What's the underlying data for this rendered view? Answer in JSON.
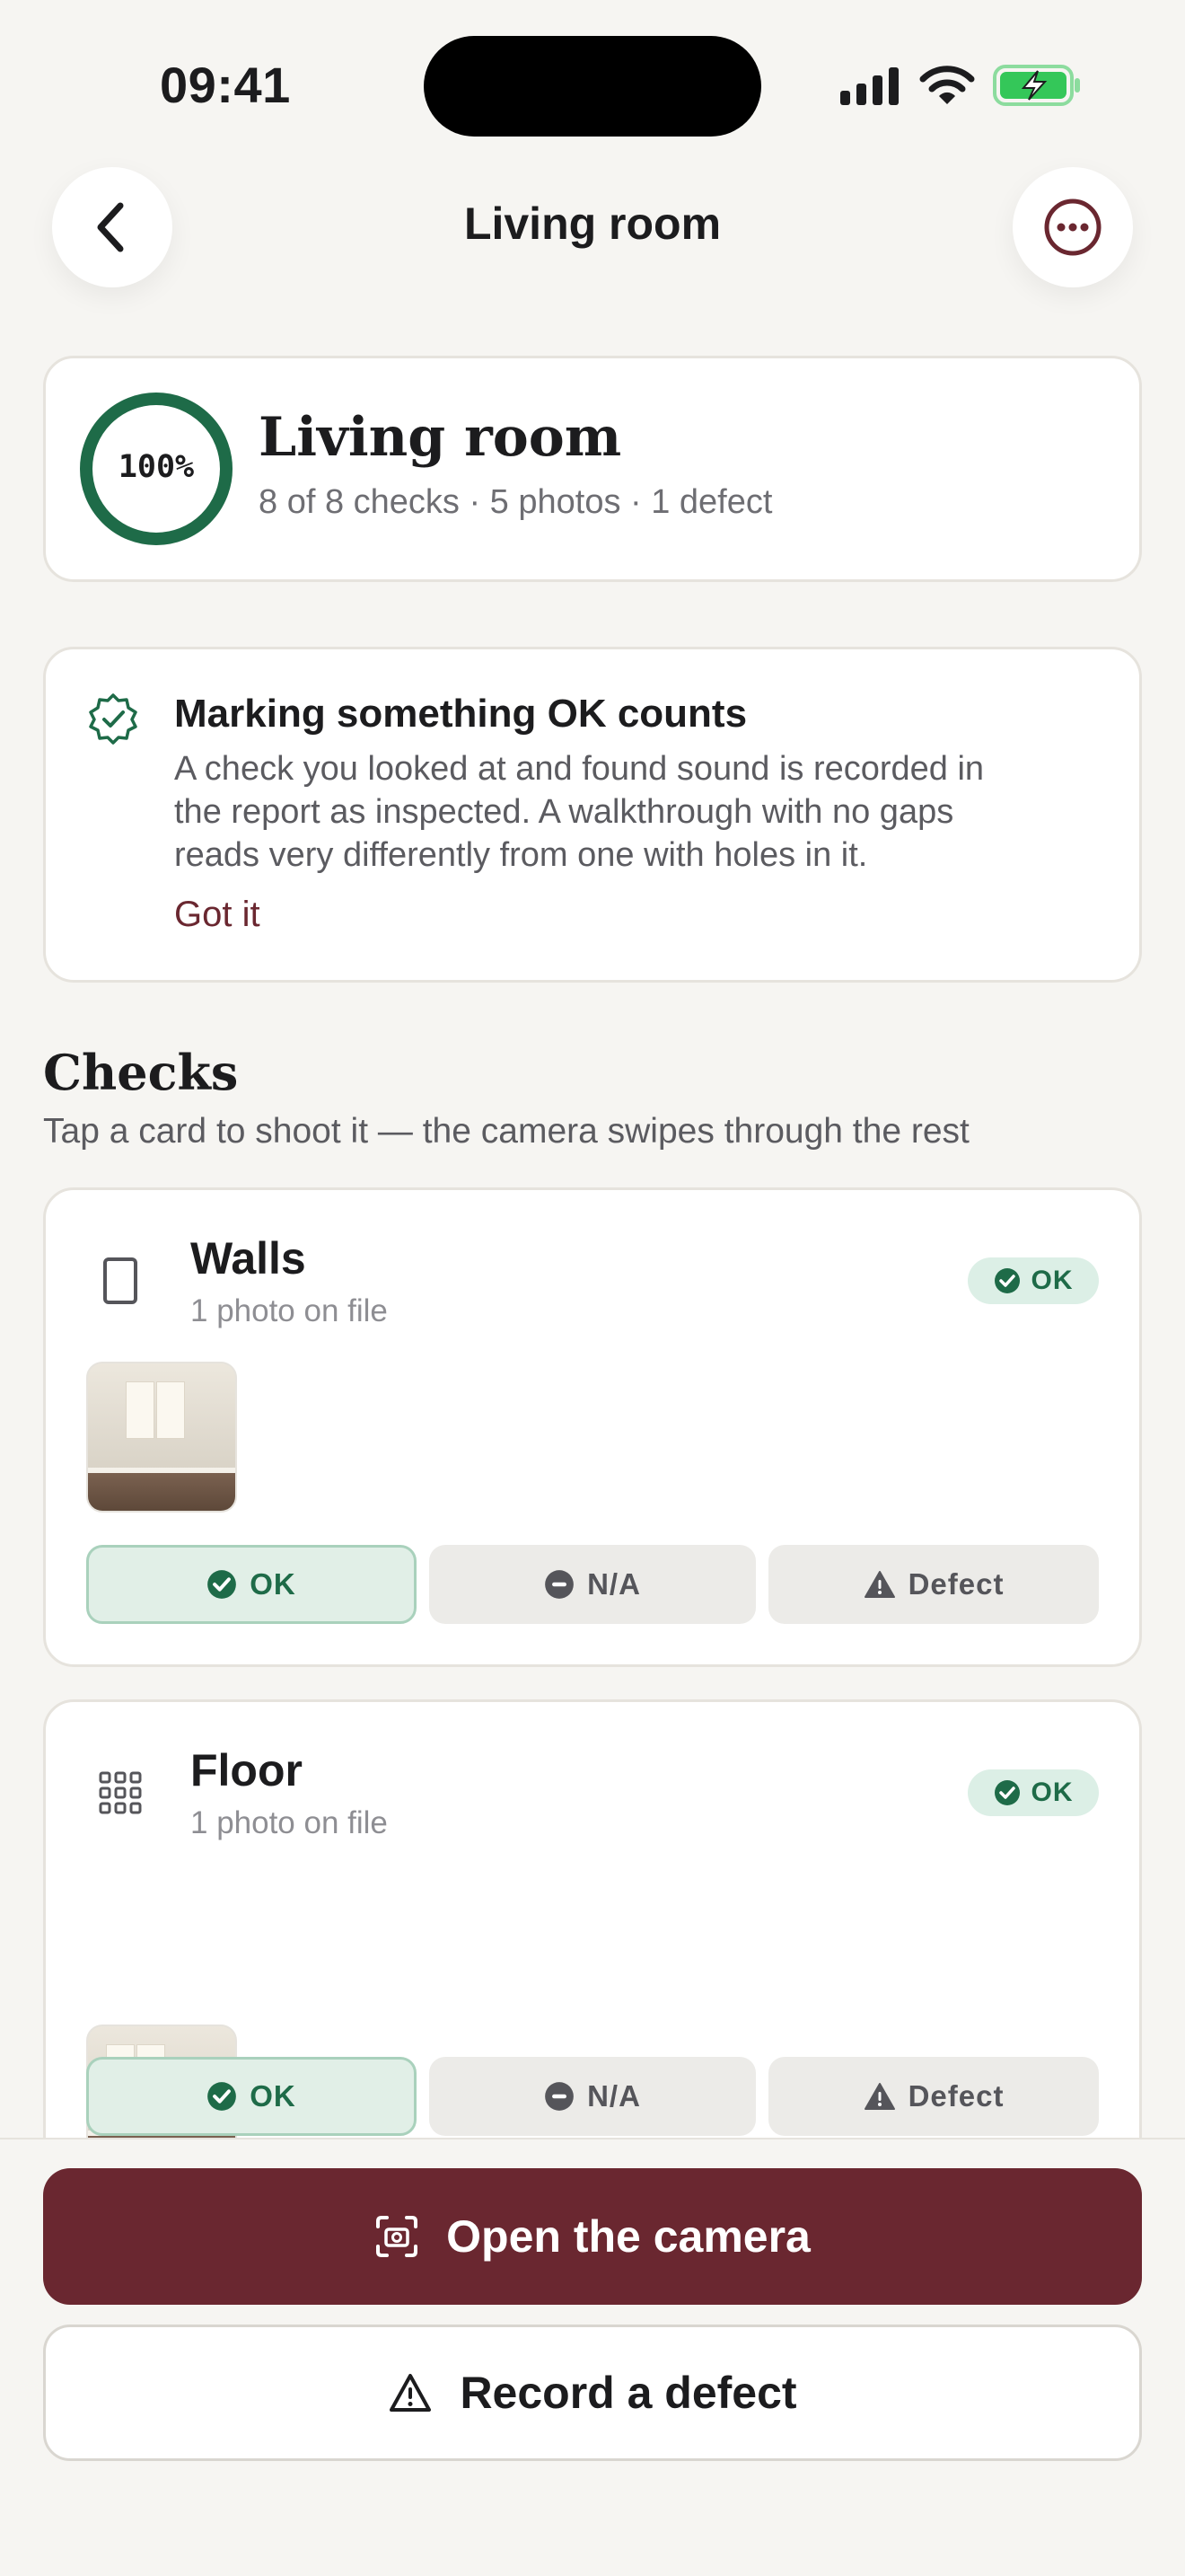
{
  "status_bar": {
    "time": "09:41"
  },
  "nav": {
    "title": "Living room",
    "back_icon": "chevron-left-icon",
    "more_icon": "ellipsis-circle-icon"
  },
  "summary": {
    "progress_label": "100%",
    "progress_fraction": 1.0,
    "title": "Living room",
    "subtitle": "8 of 8 checks · 5 photos · 1 defect",
    "ring_color": "#1e6b48"
  },
  "tip": {
    "icon": "verified-badge-icon",
    "title": "Marking something OK counts",
    "body_lines": [
      "A check you looked at and found sound is recorded in",
      "the report as inspected. A walkthrough with no gaps",
      "reads very differently from one with holes in it."
    ],
    "link": "Got it"
  },
  "checks_section": {
    "title": "Checks",
    "subtitle": "Tap a card to shoot it — the camera swipes through the rest",
    "items": [
      {
        "name": "Walls",
        "meta": "1 photo on file",
        "status": "OK",
        "icon": "wall-square-icon",
        "options": {
          "ok": "OK",
          "na": "N/A",
          "defect": "Defect"
        },
        "selected": "ok"
      },
      {
        "name": "Floor",
        "meta": "1 photo on file",
        "status": "OK",
        "icon": "floor-grid-icon",
        "options": {
          "ok": "OK",
          "na": "N/A",
          "defect": "Defect"
        },
        "selected": "ok"
      }
    ]
  },
  "actions": {
    "primary": "Open the camera",
    "primary_icon": "camera-icon",
    "secondary": "Record a defect",
    "secondary_icon": "warning-triangle-icon"
  },
  "colors": {
    "accent": "#6a2730",
    "ok_green": "#1e6b48",
    "background": "#f6f5f2"
  }
}
